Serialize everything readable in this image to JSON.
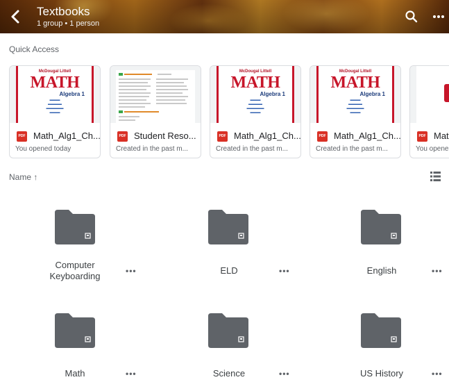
{
  "header": {
    "title": "Textbooks",
    "subtitle": "1 group • 1 person"
  },
  "quick_access": {
    "label": "Quick Access",
    "cards": [
      {
        "name": "Math_Alg1_Ch...",
        "sub": "You opened today",
        "badge": "PDF",
        "cover_title": "MATH",
        "cover_sub": "Algebra 1",
        "cover_brand": "McDougal Littell"
      },
      {
        "name": "Student Reso...",
        "sub": "Created in the past m...",
        "badge": "PDF"
      },
      {
        "name": "Math_Alg1_Ch...",
        "sub": "Created in the past m...",
        "badge": "PDF",
        "cover_title": "MATH",
        "cover_sub": "Algebra 1",
        "cover_brand": "McDougal Littell"
      },
      {
        "name": "Math_Alg1_Ch...",
        "sub": "Created in the past m...",
        "badge": "PDF",
        "cover_title": "MATH",
        "cover_sub": "Algebra 1",
        "cover_brand": "McDougal Littell"
      },
      {
        "name": "Mat",
        "sub": "You opene",
        "badge": "PDF"
      }
    ]
  },
  "sort": {
    "label": "Name ↑"
  },
  "folders": [
    {
      "line1": "Computer",
      "line2": "Keyboarding",
      "more": "•••"
    },
    {
      "line1": "ELD",
      "line2": "",
      "more": "•••"
    },
    {
      "line1": "English",
      "line2": "",
      "more": "•••"
    },
    {
      "line1": "Math",
      "line2": "",
      "more": "•••"
    },
    {
      "line1": "Science",
      "line2": "",
      "more": "•••"
    },
    {
      "line1": "US History",
      "line2": "",
      "more": "•••"
    }
  ],
  "colors": {
    "folder": "#5f6368",
    "pdf": "#d93025",
    "cover_red": "#c7162a"
  },
  "icons": {
    "back": "chevron-left-icon",
    "search": "search-icon",
    "more": "more-horizontal-icon",
    "list_view": "list-view-icon",
    "folder": "shared-folder-icon"
  }
}
